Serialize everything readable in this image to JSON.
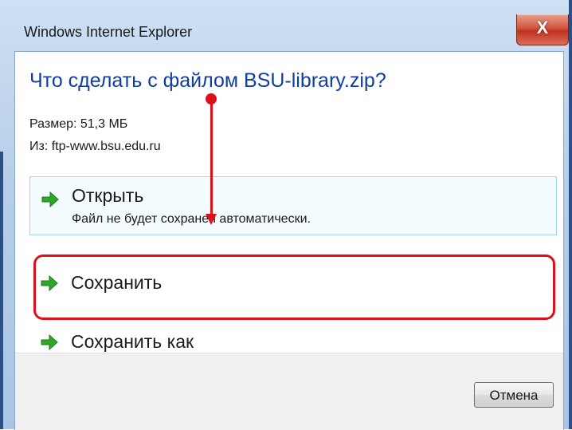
{
  "window": {
    "title": "Windows Internet Explorer",
    "close_label": "X"
  },
  "dialog": {
    "heading": "Что сделать с файлом BSU-library.zip?",
    "size": "Размер: 51,3 МБ",
    "from": "Из: ftp-www.bsu.edu.ru"
  },
  "options": [
    {
      "label": "Открыть",
      "sub": "Файл не будет сохранен автоматически."
    },
    {
      "label": "Сохранить"
    },
    {
      "label": "Сохранить как"
    }
  ],
  "footer": {
    "cancel_label": "Отмена"
  },
  "colors": {
    "heading": "#0f3da0",
    "arrow_green": "#2fa52a",
    "annotation_red": "#e0101a"
  },
  "icons": [
    "close-icon",
    "green-arrow-icon"
  ]
}
